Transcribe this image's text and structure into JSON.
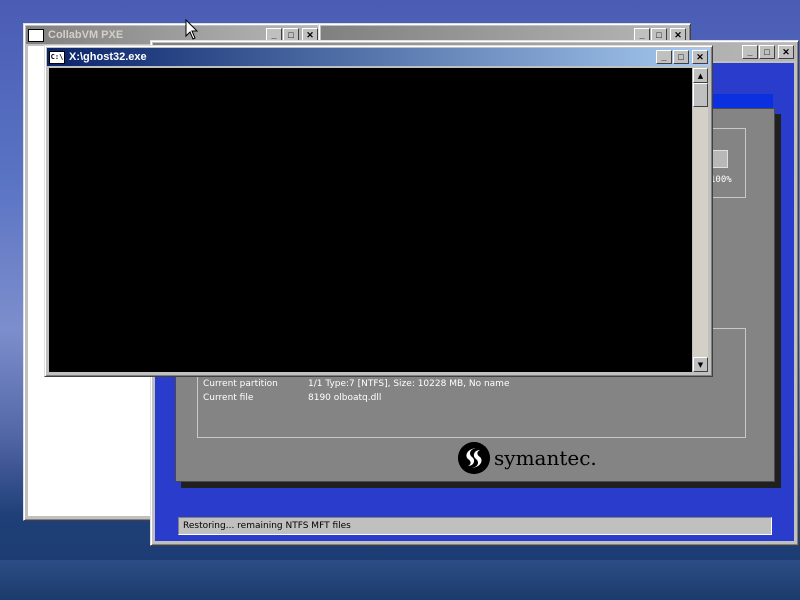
{
  "collabvm_window": {
    "title": "CollabVM PXE"
  },
  "background_window": {
    "title": ""
  },
  "ghost_window": {
    "current_partition_label": "Current partition",
    "current_partition_value": "1/1 Type:7 [NTFS], Size: 10228 MB, No name",
    "current_file_label": "Current file",
    "current_file_value": "8190 olboatq.dll",
    "progress_percent_label": "100%",
    "brand": "symantec.",
    "status_text": "Restoring... remaining NTFS MFT files"
  },
  "console_window": {
    "icon_text": "C:\\",
    "title": "X:\\ghost32.exe"
  },
  "title_buttons": {
    "minimize": "_",
    "maximize": "□",
    "close": "✕"
  },
  "scrollbar": {
    "up": "▲",
    "down": "▼"
  },
  "colors": {
    "active_title": "#0a246a",
    "console_bg": "#000000",
    "ghost_blue": "#2a3ccc"
  }
}
